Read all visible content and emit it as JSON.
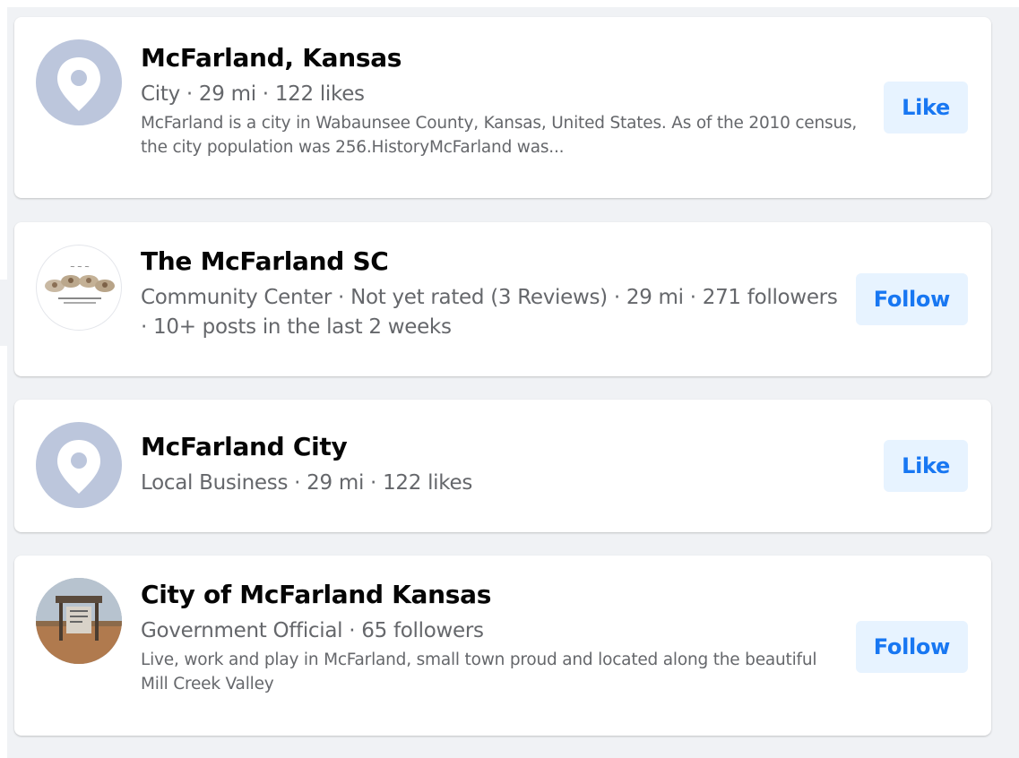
{
  "results": [
    {
      "title": "McFarland, Kansas",
      "meta": "City · 29 mi · 122 likes",
      "description": "McFarland is a city in Wabaunsee County, Kansas, United States. As of the 2010 census, the city population was 256.HistoryMcFarland was...",
      "button": "Like",
      "avatar_icon": "location-pin-icon"
    },
    {
      "title": "The McFarland SC",
      "meta": "Community Center · Not yet rated (3 Reviews) · 29 mi · 271 followers · 10+ posts in the last 2 weeks",
      "button": "Follow",
      "avatar_icon": "community-logo"
    },
    {
      "title": "McFarland City",
      "meta": "Local Business · 29 mi · 122 likes",
      "button": "Like",
      "avatar_icon": "location-pin-icon"
    },
    {
      "title": "City of McFarland Kansas",
      "meta": "Government Official · 65 followers",
      "description": "Live, work and play in McFarland, small town proud and located along the beautiful Mill Creek Valley",
      "button": "Follow",
      "avatar_icon": "town-sign-photo"
    }
  ],
  "colors": {
    "accent": "#1877f2",
    "button_bg": "#e7f3ff",
    "background": "#f0f2f5",
    "secondary_text": "#65676b",
    "pin_avatar": "#bcc6dc"
  }
}
